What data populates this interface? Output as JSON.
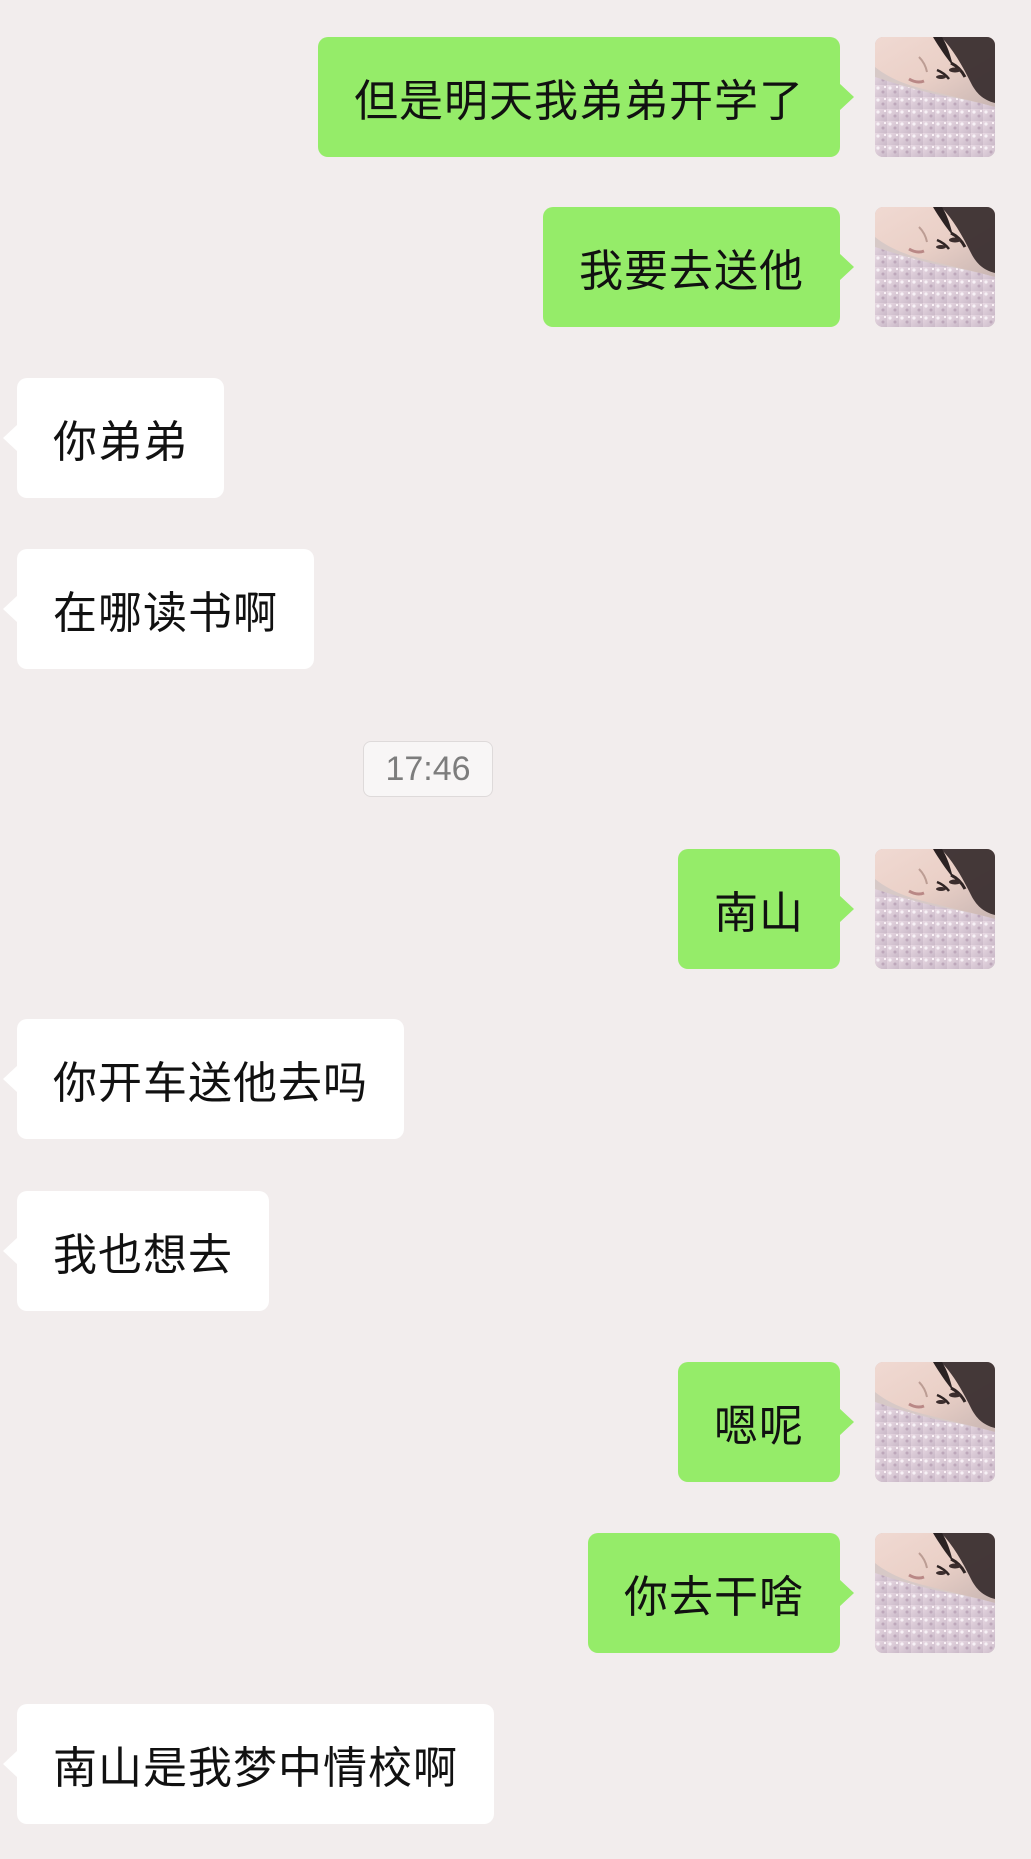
{
  "conversation": {
    "timestamp": "17:46",
    "messages": [
      {
        "side": "outgoing",
        "text": "但是明天我弟弟开学了"
      },
      {
        "side": "outgoing",
        "text": "我要去送他"
      },
      {
        "side": "incoming",
        "text": "你弟弟"
      },
      {
        "side": "incoming",
        "text": "在哪读书啊"
      },
      {
        "side": "outgoing",
        "text": "南山"
      },
      {
        "side": "incoming",
        "text": "你开车送他去吗"
      },
      {
        "side": "incoming",
        "text": "我也想去"
      },
      {
        "side": "outgoing",
        "text": "嗯呢"
      },
      {
        "side": "outgoing",
        "text": "你去干啥"
      },
      {
        "side": "incoming",
        "text": "南山是我梦中情校啊"
      }
    ]
  },
  "colors": {
    "outgoing_bubble": "#95ec69",
    "incoming_bubble": "#ffffff",
    "background": "#f2eded"
  },
  "icons": {
    "avatar": "user-avatar-photo"
  }
}
